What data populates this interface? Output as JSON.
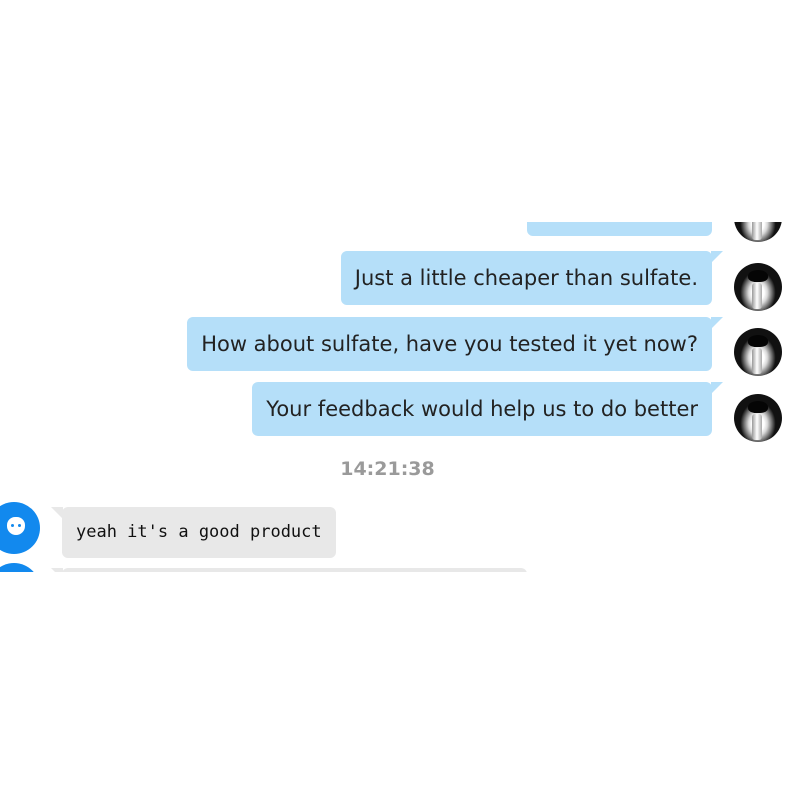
{
  "chat": {
    "outgoing_messages": [
      {
        "text": ""
      },
      {
        "text": "Just a little cheaper than sulfate."
      },
      {
        "text": "How about sulfate, have you tested it yet now?"
      },
      {
        "text": "Your feedback would help us to do better"
      }
    ],
    "timestamp": "14:21:38",
    "incoming_messages": [
      {
        "text": "yeah it's a good product"
      },
      {
        "text": ""
      }
    ]
  },
  "colors": {
    "outgoing_bubble": "#b5dff9",
    "incoming_bubble": "#e8e8e8",
    "user_avatar": "#1289ee",
    "timestamp_text": "#9a9a9a"
  },
  "icons": {
    "agent_avatar": "agent-avatar-icon",
    "user_avatar": "user-avatar-icon"
  }
}
